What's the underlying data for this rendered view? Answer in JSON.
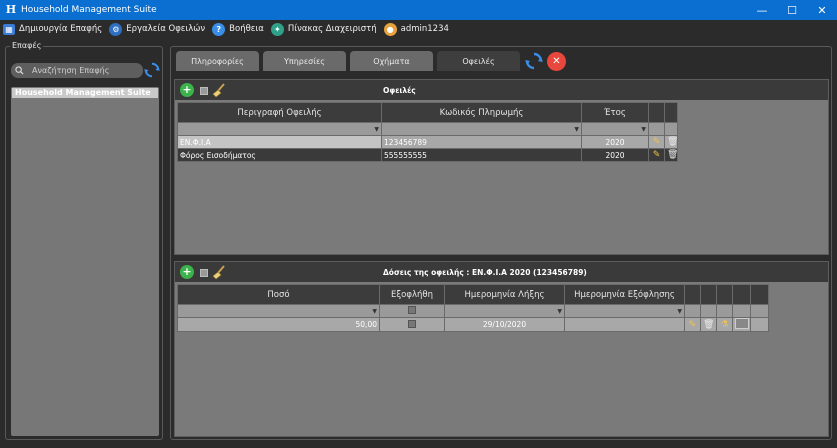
{
  "window": {
    "title": "Household Management Suite",
    "icon_letter": "H"
  },
  "menu": {
    "items": [
      {
        "label": "Δημιουργία Επαφής",
        "icon": "contact-card-icon"
      },
      {
        "label": "Εργαλεία Οφειλών",
        "icon": "tools-icon"
      },
      {
        "label": "Βοήθεια",
        "icon": "help-icon"
      },
      {
        "label": "Πίνακας Διαχειριστή",
        "icon": "admin-panel-icon"
      },
      {
        "label": "admin1234",
        "icon": "user-icon"
      }
    ]
  },
  "sidebar": {
    "legend": "Επαφές",
    "search_placeholder": "Αναζήτηση Επαφής",
    "tree_root": "Household Management Suite"
  },
  "tabs": [
    {
      "label": "Πληροφορίες",
      "active": false
    },
    {
      "label": "Υπηρεσίες",
      "active": false
    },
    {
      "label": "Οχήματα",
      "active": false
    },
    {
      "label": "Οφειλές",
      "active": true
    }
  ],
  "debts": {
    "title": "Οφειλές",
    "columns": [
      "Περιγραφή Οφειλής",
      "Κωδικός Πληρωμής",
      "Έτος"
    ],
    "rows": [
      {
        "description": "ΕΝ.Φ.Ι.Α",
        "payment_code": "123456789",
        "year": "2020",
        "selected": true
      },
      {
        "description": "Φόρος Εισοδήματος",
        "payment_code": "555555555",
        "year": "2020",
        "selected": false
      }
    ]
  },
  "installments": {
    "title": "Δόσεις της οφειλής : ΕΝ.Φ.Ι.Α 2020 (123456789)",
    "columns": [
      "Ποσό",
      "Εξοφλήθη",
      "Ημερομηνία Λήξης",
      "Ημερομηνία Εξόφλησης"
    ],
    "rows": [
      {
        "amount": "50,00",
        "paid": false,
        "due_date": "29/10/2020",
        "paid_date": ""
      }
    ]
  },
  "colors": {
    "titlebar": "#0a6fd0",
    "accent_green": "#3bb34a",
    "close_red": "#e8473d",
    "refresh_blue": "#3a8ee6"
  }
}
